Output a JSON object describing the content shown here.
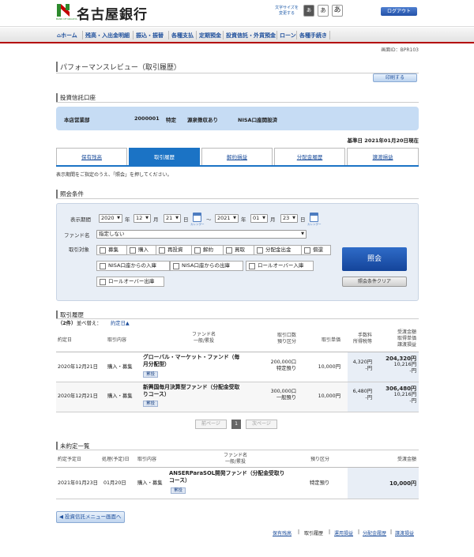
{
  "header": {
    "bank_name": "名古屋銀行",
    "logo_sub": "BANK OF NAGOYA",
    "font_size_label_1": "文字サイズを",
    "font_size_label_2": "変更する",
    "font_small": "あ",
    "font_medium": "あ",
    "font_large": "あ",
    "logout": "ログアウト"
  },
  "nav": {
    "items": [
      "ホーム",
      "残高・入出金明細",
      "振込・振替",
      "各種支払",
      "定期預金",
      "投資信託・外貨預金",
      "ローン",
      "各種手続き"
    ]
  },
  "screen_id": "画面ID：BPR103",
  "page_title": "パフォーマンスレビュー（取引履歴）",
  "print_button": "印刷する",
  "account": {
    "section_title": "投資信託口座",
    "branch": "本店営業部",
    "number": "2000001",
    "type": "特定",
    "tax": "源泉徴収あり",
    "nisa": "NISA口座開設済"
  },
  "base_date": "基準日 2021年01月20日現在",
  "tabs": [
    "保有残高",
    "取引履歴",
    "解約損益",
    "分配金履歴",
    "譲渡損益"
  ],
  "active_tab": 1,
  "instruction": "表示期間をご指定のうえ、「照会」を押してください。",
  "search": {
    "section_title": "照会条件",
    "period_label": "表示期間",
    "from_year": "2020",
    "year_unit": "年",
    "from_month": "12",
    "month_unit": "月",
    "from_day": "21",
    "day_unit": "日",
    "tilde": "～",
    "to_year": "2021",
    "to_month": "01",
    "to_day": "23",
    "calendar_caption": "カレンダー",
    "fund_label": "ファンド名",
    "fund_value": "指定しない",
    "trade_label": "取引対象",
    "checkboxes": [
      "募集",
      "購入",
      "再投資",
      "解約",
      "買取",
      "分配金出金",
      "償還",
      "NISA口座からの入庫",
      "NISA口座からの出庫",
      "ロールオーバー入庫",
      "ロールオーバー出庫"
    ],
    "search_button": "照会",
    "clear_button": "照会条件クリア"
  },
  "history": {
    "section_title": "取引履歴",
    "count": "（2件）",
    "sort_label": "並べ替え：",
    "sort_value": "約定日▲",
    "headers": {
      "date": "約定日",
      "content": "取引内容",
      "fund_1": "ファンド名",
      "fund_2": "一般/累投",
      "qty_1": "取引口数",
      "qty_2": "預り区分",
      "price": "取引単価",
      "fee_1": "手数料",
      "fee_2": "所得税等",
      "amt_1": "受渡金額",
      "amt_2": "取得単価",
      "amt_3": "譲渡損益"
    },
    "rows": [
      {
        "date": "2020年12月21日",
        "content": "購入・募集",
        "fund_line1": "グローバル・マーケット・ファンド（毎",
        "fund_line2": "月分配型）",
        "badge": "累投",
        "qty": "200,000口",
        "custody": "特定預り",
        "price": "10,000円",
        "fee": "4,320円",
        "tax": "-円",
        "amount": "204,320円",
        "unit_cost": "10,216円",
        "gain": "-円"
      },
      {
        "date": "2020年12月21日",
        "content": "購入・募集",
        "fund_line1": "新興国毎月決算型ファンド（分配金受取",
        "fund_line2": "りコース）",
        "badge": "累投",
        "qty": "300,000口",
        "custody": "一般預り",
        "price": "10,000円",
        "fee": "6,480円",
        "tax": "-円",
        "amount": "306,480円",
        "unit_cost": "10,216円",
        "gain": "-円"
      }
    ],
    "pager": {
      "prev": "前ページ",
      "current": "1",
      "next": "次ページ"
    }
  },
  "pending": {
    "section_title": "未約定一覧",
    "headers": {
      "due": "約定予定日",
      "proc": "処理(予定)日",
      "content": "取引内容",
      "fund_1": "ファンド名",
      "fund_2": "一般/累投",
      "custody": "預り区分",
      "amount": "受渡金額"
    },
    "rows": [
      {
        "due": "2021年01月23日",
        "proc": "01月20日",
        "content": "購入・募集",
        "fund_line1": "ANSERParaSOL開発ファンド（分配金受取り",
        "fund_line2": "コース）",
        "badge": "累投",
        "custody": "特定預り",
        "amount": "10,000円"
      }
    ]
  },
  "back_button": "投資信託メニュー画面へ",
  "footer_links": [
    "保有残高",
    "取引履歴",
    "運用損益",
    "分配金履歴",
    "譲渡損益"
  ],
  "colors": {
    "brand_green": "#2d8a2d",
    "brand_red": "#b30000",
    "tab_active": "#1b73c5",
    "account_bg": "#c6dcf4",
    "negative_red": "#d00000"
  }
}
